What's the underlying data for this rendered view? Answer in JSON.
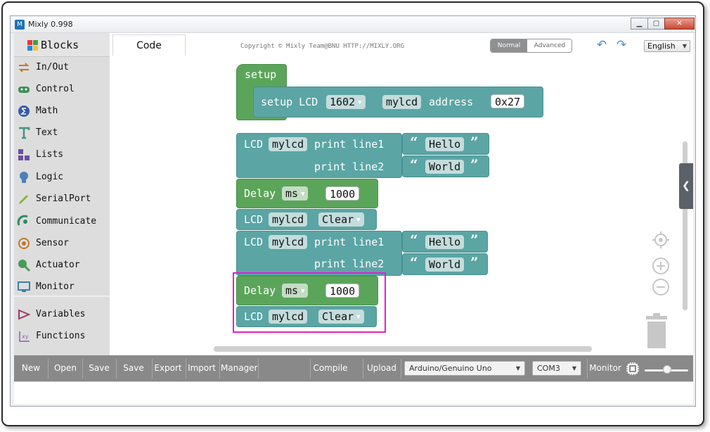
{
  "window": {
    "title": "Mixly 0.998",
    "app_icon_letter": "M",
    "min_glyph": "▁",
    "max_glyph": "▢",
    "close_glyph": "✕"
  },
  "header": {
    "code_tab": "Code",
    "copyright": "Copyright © Mixly Team@BNU HTTP://MIXLY.ORG",
    "mode_normal": "Normal",
    "mode_advanced": "Advanced",
    "undo_glyph": "↶",
    "redo_glyph": "↷",
    "language": "English"
  },
  "sidebar": {
    "header_label": "Blocks",
    "items": [
      {
        "label": "In/Out",
        "icon": "arrows-icon"
      },
      {
        "label": "Control",
        "icon": "gamepad-icon"
      },
      {
        "label": "Math",
        "icon": "sigma-icon"
      },
      {
        "label": "Text",
        "icon": "text-t-icon"
      },
      {
        "label": "Lists",
        "icon": "lists-icon"
      },
      {
        "label": "Logic",
        "icon": "bulb-icon"
      },
      {
        "label": "SerialPort",
        "icon": "pen-icon"
      },
      {
        "label": "Communicate",
        "icon": "satellite-icon"
      },
      {
        "label": "Sensor",
        "icon": "sensor-icon"
      },
      {
        "label": "Actuator",
        "icon": "actuator-icon"
      },
      {
        "label": "Monitor",
        "icon": "monitor-icon"
      },
      {
        "label": "Variables",
        "icon": "variables-icon"
      },
      {
        "label": "Functions",
        "icon": "function-icon"
      }
    ]
  },
  "blocks": {
    "setup": {
      "hat_label": "setup",
      "lcd_label": "setup LCD",
      "lcd_type": "1602",
      "lcd_name": "mylcd",
      "address_label": "address",
      "address_value": "0x27"
    },
    "print1": {
      "prefix": "LCD",
      "name": "mylcd",
      "line1_label": "print line1",
      "line1_value": "Hello",
      "line2_label": "print line2",
      "line2_value": "World"
    },
    "delay1": {
      "label": "Delay",
      "unit": "ms",
      "value": "1000"
    },
    "clear1": {
      "prefix": "LCD",
      "name": "mylcd",
      "action": "Clear"
    },
    "print2": {
      "prefix": "LCD",
      "name": "mylcd",
      "line1_label": "print line1",
      "line1_value": "Hello",
      "line2_label": "print line2",
      "line2_value": "World"
    },
    "delay2": {
      "label": "Delay",
      "unit": "ms",
      "value": "1000"
    },
    "clear2": {
      "prefix": "LCD",
      "name": "mylcd",
      "action": "Clear"
    },
    "dropdown_glyph": "▼",
    "quote_open": "“",
    "quote_close": "”"
  },
  "toolbar": {
    "new": "New",
    "open": "Open",
    "save": "Save",
    "save_as": "Save as",
    "export": "Export",
    "import": "Import",
    "manager": "Manager",
    "compile": "Compile",
    "upload": "Upload",
    "board": "Arduino/Genuino Uno",
    "port": "COM3",
    "monitor": "Monitor",
    "select_arrow": "▼"
  },
  "colors": {
    "block_teal": "#5ba5a5",
    "block_green": "#5ba55b",
    "highlight": "#e020d0",
    "toolbar": "#898989"
  }
}
